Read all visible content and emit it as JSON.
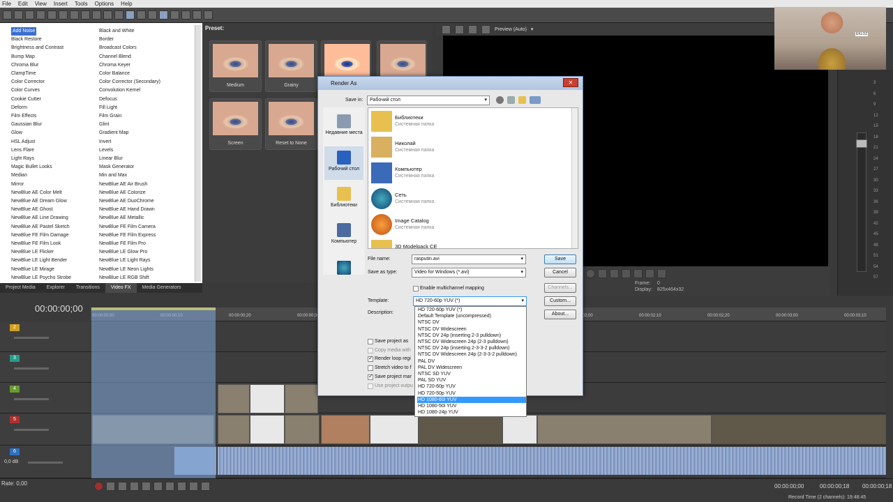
{
  "menubar": [
    "File",
    "Edit",
    "View",
    "Insert",
    "Tools",
    "Options",
    "Help"
  ],
  "fx": {
    "left": [
      "Add Noise",
      "Black Restore",
      "Brightness and Contrast",
      "Bump Map",
      "Chroma Blur",
      "ClampTime",
      "Color Corrector",
      "Color Curves",
      "Cookie Cutter",
      "Deform",
      "Film Effects",
      "Gaussian Blur",
      "Glow",
      "HSL Adjust",
      "Lens Flare",
      "Light Rays",
      "Magic Bullet Looks",
      "Median",
      "Mirror",
      "NewBlue AE Color Melt",
      "NewBlue AE Dream Glow",
      "NewBlue AE Ghost",
      "NewBlue AE Line Drawing",
      "NewBlue AE Pastel Sketch",
      "NewBlue FE Film Damage",
      "NewBlue FE Film Look",
      "NewBlue LE Flicker",
      "NewBlue LE Light Bender",
      "NewBlue LE Mirage",
      "NewBlue LE Psycho Strobe"
    ],
    "right": [
      "Black and White",
      "Border",
      "Broadcast Colors",
      "Channel Blend",
      "Chroma Keyer",
      "Color Balance",
      "Color Corrector (Secondary)",
      "Convolution Kernel",
      "Defocus",
      "Fill Light",
      "Film Grain",
      "Glint",
      "Gradient Map",
      "Invert",
      "Levels",
      "Linear Blur",
      "Mask Generator",
      "Min and Max",
      "NewBlue AE Air Brush",
      "NewBlue AE Colorize",
      "NewBlue AE DuoChrome",
      "NewBlue AE Hand Drawn",
      "NewBlue AE Metallic",
      "NewBlue FE Film Camera",
      "NewBlue FE Film Express",
      "NewBlue FE Film Pro",
      "NewBlue LE Glow Pro",
      "NewBlue LE Light Rays",
      "NewBlue LE Neon Lights",
      "NewBlue LE RGB Shift"
    ]
  },
  "preset": {
    "title": "Preset:",
    "thumbs": [
      "Medium",
      "Grainy",
      "",
      "",
      "Screen",
      "Reset to None"
    ]
  },
  "tabs": [
    "Project Media",
    "Explorer",
    "Transitions",
    "Video FX",
    "Media Generators"
  ],
  "preview": {
    "mode": "Preview (Auto)",
    "frame_label": "Frame:",
    "frame_value": "0",
    "display_label": "Display:",
    "display_value": "825x464x32",
    "webcam_text": "EKLOZ"
  },
  "timeline": {
    "timecode": "00:00:00;00",
    "ruler": [
      "00:00:00;00",
      "00:00:00;10",
      "00:00:00;20",
      "00:00:00;30",
      "00:00:01;00",
      "00:00:01;10",
      "00:00:01;20",
      "00:00:02;00",
      "00:00:02;10",
      "00:00:02;20",
      "00:00:03;00",
      "00:00:03;10",
      "00:00:03;20"
    ],
    "tracks": [
      "2",
      "3",
      "4",
      "5",
      "6"
    ],
    "audio_level": "0,0 dB",
    "rate": "Rate: 0,00",
    "tc1": "00:00:00;00",
    "tc2": "00:00:00;18",
    "tc3": "00:00:00;18",
    "record": "Record Time (2 channels): 19:48:45"
  },
  "dialog": {
    "title": "Render As",
    "save_in_label": "Save in:",
    "save_in_value": "Рабочий стол",
    "places": [
      "Недавние места",
      "Рабочий стол",
      "Библиотеки",
      "Компьютер",
      ""
    ],
    "files": [
      {
        "name": "Библиотеки",
        "sub": "Системная папка"
      },
      {
        "name": "Николай",
        "sub": "Системная папка"
      },
      {
        "name": "Компьютер",
        "sub": "Системная папка"
      },
      {
        "name": "Сеть",
        "sub": "Системная папка"
      },
      {
        "name": "Image Catalog",
        "sub": "Системная папка"
      },
      {
        "name": "3D Modelpack CE",
        "sub": ""
      }
    ],
    "filename_label": "File name:",
    "filename_value": "rasputin.avi",
    "saveas_label": "Save as type:",
    "saveas_value": "Video for Windows (*.avi)",
    "multichannel": "Enable multichannel mapping",
    "template_label": "Template:",
    "template_value": "HD 720-60p YUV (*)",
    "description_label": "Description:",
    "save": "Save",
    "cancel": "Cancel",
    "channels": "Channels...",
    "custom": "Custom...",
    "about": "About...",
    "options": [
      "Save project as",
      "Copy media with",
      "Render loop regi",
      "Stretch video to f",
      "Save project mar",
      "Use project outpu"
    ]
  },
  "dropdown": [
    "HD 720-60p YUV (*)",
    "Default Template (uncompressed)",
    "NTSC DV",
    "NTSC DV Widescreen",
    "NTSC DV 24p (inserting 2-3 pulldown)",
    "NTSC DV Widescreen 24p (2-3 pulldown)",
    "NTSC DV 24p (inserting 2-3-3-2 pulldown)",
    "NTSC DV Widescreen 24p (2-3-3-2 pulldown)",
    "PAL DV",
    "PAL DV Widescreen",
    "NTSC SD YUV",
    "PAL SD YUV",
    "HD 720-60p YUV",
    "HD 720-50p YUV",
    "HD 1080-60i YUV",
    "HD 1080-50i YUV",
    "HD 1080-24p YUV"
  ],
  "meter_labels": [
    "3",
    "6",
    "9",
    "12",
    "15",
    "18",
    "21",
    "24",
    "27",
    "30",
    "33",
    "36",
    "39",
    "42",
    "45",
    "48",
    "51",
    "54",
    "57"
  ]
}
